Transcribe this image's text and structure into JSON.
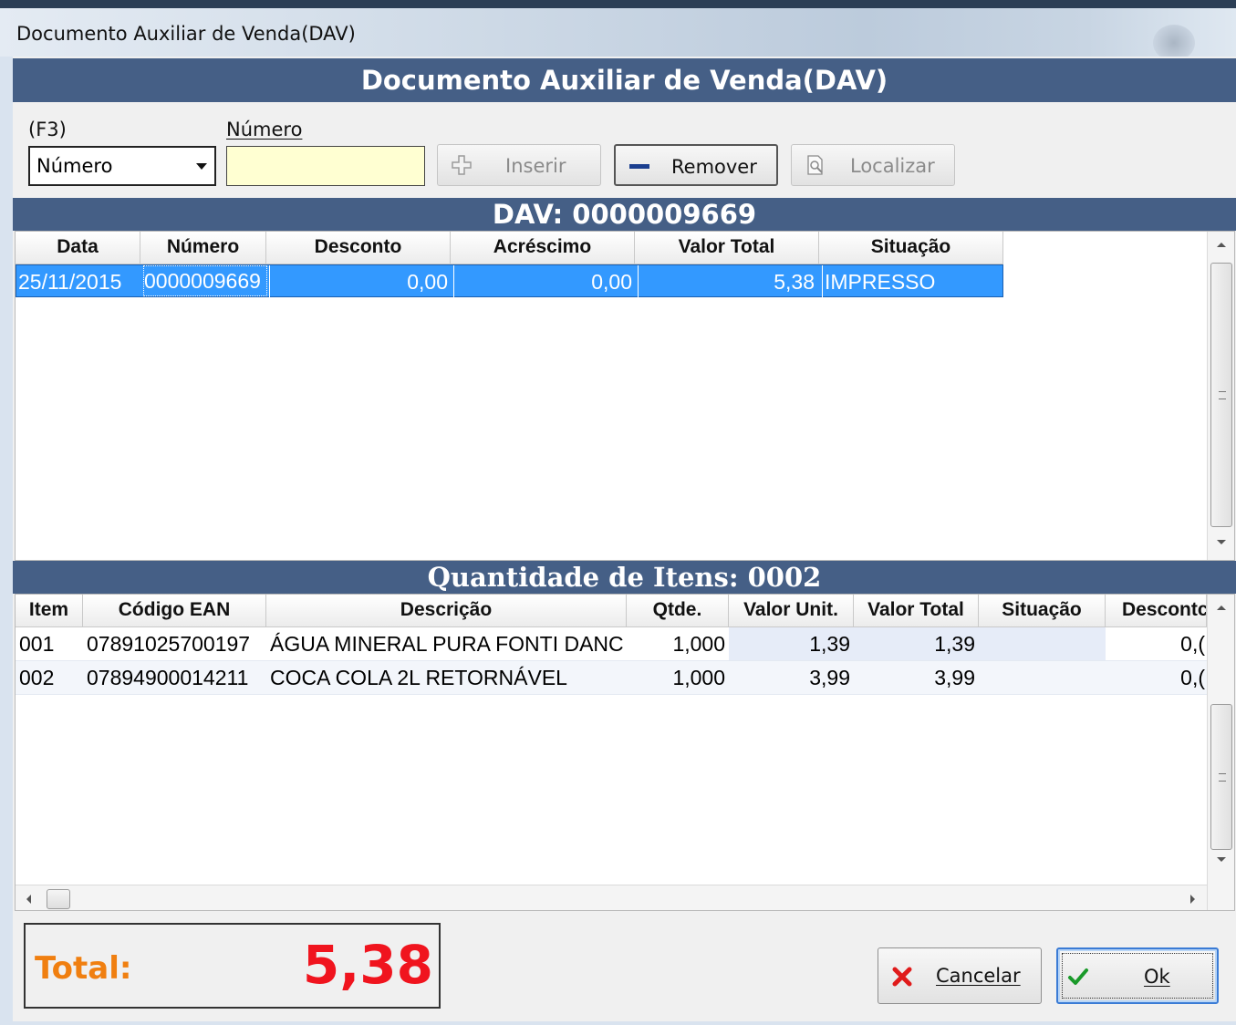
{
  "window": {
    "title": "Documento Auxiliar de Venda(DAV)"
  },
  "header": {
    "title": "Documento Auxiliar de Venda(DAV)"
  },
  "search": {
    "f3_label": "(F3)",
    "numero_label": "Número",
    "field_selected": "Número",
    "value": ""
  },
  "toolbar": {
    "inserir": "Inserir",
    "remover": "Remover",
    "localizar": "Localizar"
  },
  "dav": {
    "title": "DAV: 0000009669",
    "columns": [
      "Data",
      "Número",
      "Desconto",
      "Acréscimo",
      "Valor Total",
      "Situação"
    ],
    "rows": [
      {
        "data": "25/11/2015",
        "numero": "0000009669",
        "desconto": "0,00",
        "acrescimo": "0,00",
        "valor_total": "5,38",
        "situacao": "IMPRESSO"
      }
    ]
  },
  "items": {
    "title": "Quantidade de Itens: 0002",
    "columns": [
      "Item",
      "Código EAN",
      "Descrição",
      "Qtde.",
      "Valor Unit.",
      "Valor Total",
      "Situação",
      "Descontc"
    ],
    "rows": [
      {
        "item": "001",
        "ean": "07891025700197",
        "descricao": "ÁGUA MINERAL PURA FONTI DANC",
        "qtde": "1,000",
        "valor_unit": "1,39",
        "valor_total": "1,39",
        "situacao": "",
        "desconto": "0,("
      },
      {
        "item": "002",
        "ean": "07894900014211",
        "descricao": "COCA COLA 2L RETORNÁVEL",
        "qtde": "1,000",
        "valor_unit": "3,99",
        "valor_total": "3,99",
        "situacao": "",
        "desconto": "0,("
      }
    ]
  },
  "total": {
    "label": "Total:",
    "value": "5,38"
  },
  "actions": {
    "cancelar": "Cancelar",
    "ok": "Ok"
  },
  "colors": {
    "banner": "#455f86",
    "selection": "#3399ff",
    "total_label": "#f07f10",
    "total_value": "#f0141e",
    "input_bg": "#ffffd2"
  }
}
